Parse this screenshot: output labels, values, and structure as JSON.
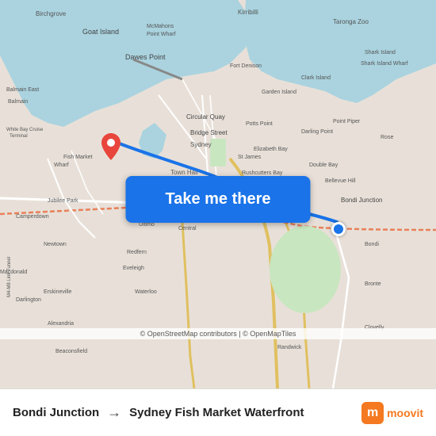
{
  "map": {
    "attribution": "© OpenStreetMap contributors | © OpenMapTiles",
    "backgroundColor": "#e8e0d8",
    "waterColor": "#aad3df",
    "roadColor": "#ffffff",
    "parkColor": "#c8e6c0"
  },
  "button": {
    "label": "Take me there",
    "backgroundColor": "#1a73e8",
    "textColor": "#ffffff"
  },
  "origin": {
    "label": "Bondi Junction",
    "pinColor": "#e8453c"
  },
  "destination": {
    "label": "Sydney Fish Market Waterfront",
    "pinColor": "#1a73e8"
  },
  "arrow": {
    "symbol": "→"
  },
  "moovit": {
    "text": "moovit",
    "letter": "m",
    "color": "#f47920"
  },
  "places": {
    "goat_island": "Goat Island",
    "dawes_point": "Dawes Point",
    "fish_market": "Fish Market"
  }
}
